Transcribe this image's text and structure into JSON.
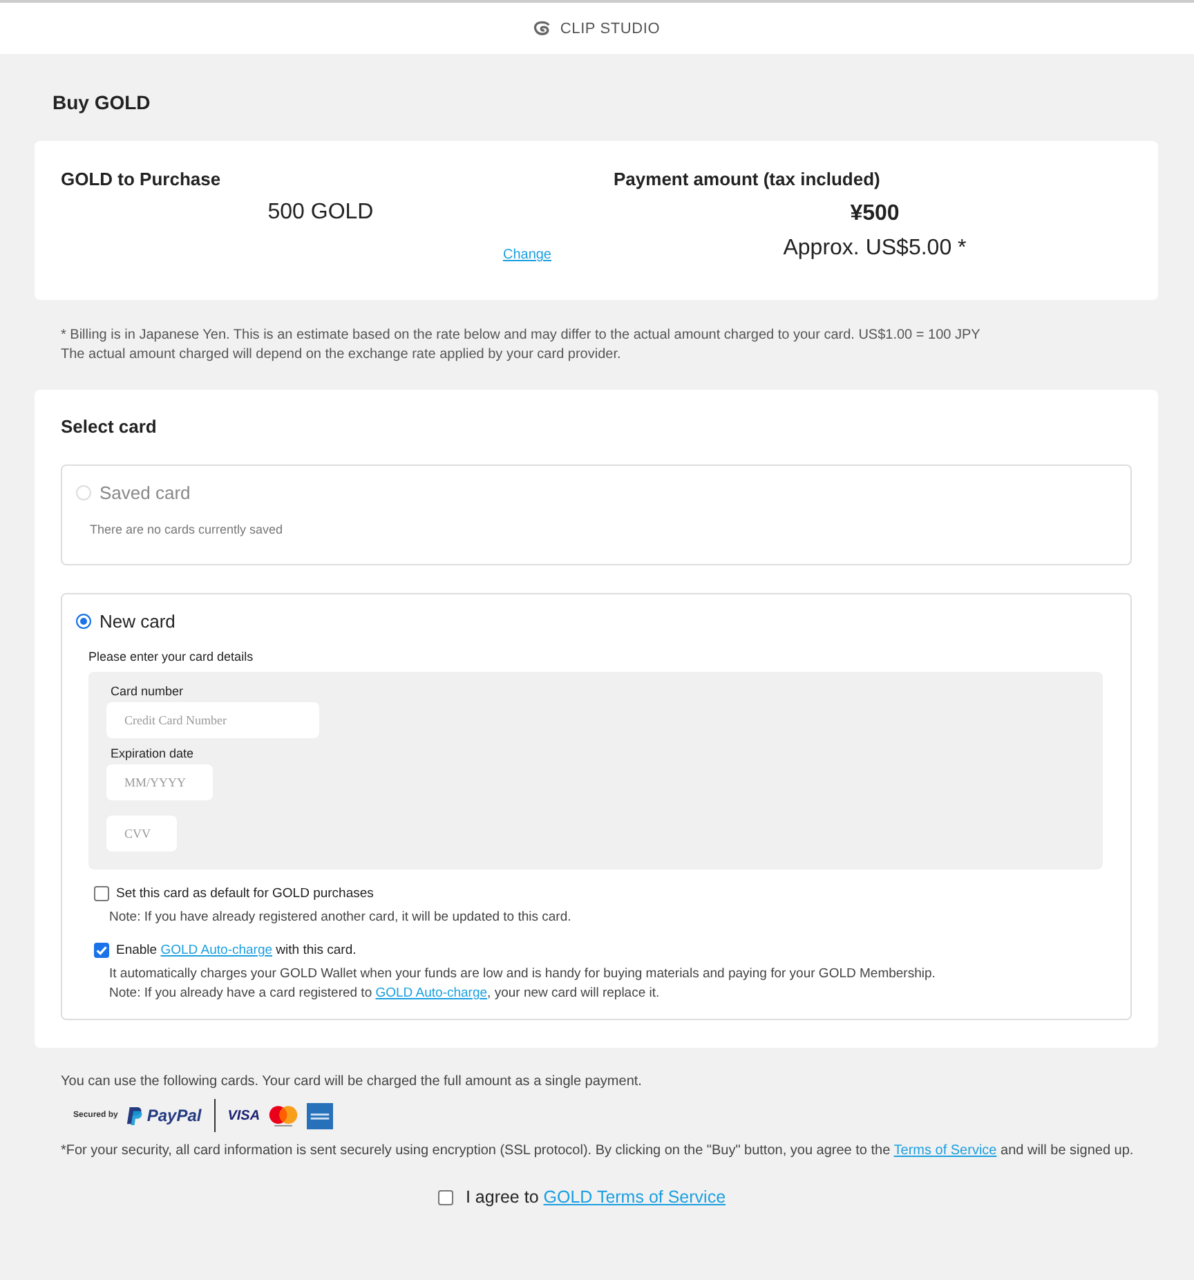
{
  "header": {
    "brand": "CLIP STUDIO"
  },
  "page_title": "Buy GOLD",
  "summary": {
    "purchase_label": "GOLD to Purchase",
    "purchase_value": "500 GOLD",
    "change_link": "Change",
    "payment_label": "Payment amount (tax included)",
    "payment_yen": "¥500",
    "payment_usd": "Approx. US$5.00 *"
  },
  "notes": [
    "* Billing is in Japanese Yen. This is an estimate based on the rate below and may differ to the actual amount charged to your card. US$1.00 = 100 JPY",
    "The actual amount charged will depend on the exchange rate applied by your card provider."
  ],
  "select_card": {
    "title": "Select card",
    "options": [
      {
        "kind": "saved",
        "label": "Saved card",
        "selected": false,
        "disabled": true,
        "message": "There are no cards currently saved"
      },
      {
        "kind": "new",
        "label": "New card",
        "selected": true,
        "disabled": false,
        "instruction": "Please enter your card details",
        "fields": [
          {
            "label": "Card number",
            "placeholder": "Credit Card Number",
            "kind": "number"
          },
          {
            "label": "Expiration date",
            "placeholder": "MM/YYYY",
            "kind": "expiry"
          },
          {
            "placeholder": "CVV",
            "kind": "cvv"
          }
        ],
        "checkboxes": [
          {
            "checked": false,
            "label": {
              "before": "Set this card as default for GOLD purchases"
            },
            "notes": [
              {
                "before": "Note: If you have already registered another card, it will be updated to this card."
              }
            ]
          },
          {
            "checked": true,
            "label": {
              "before": "Enable ",
              "link": "GOLD Auto-charge",
              "after": " with this card."
            },
            "notes": [
              {
                "before": "It automatically charges your GOLD Wallet when your funds are low and is handy for buying materials and paying for your GOLD Membership."
              },
              {
                "before": "Note: If you already have a card registered to ",
                "link": "GOLD Auto-charge",
                "after": ", your new card will replace it."
              }
            ]
          }
        ]
      }
    ]
  },
  "cards_info": "You can use the following cards. Your card will be charged the full amount as a single payment.",
  "logos": {
    "secured_by": "Secured by",
    "paypal": "PayPal",
    "visa": "VISA"
  },
  "security_note": {
    "before": "*For your security, all card information is sent securely using encryption (SSL protocol). By clicking on the \"Buy\" button, you agree to the ",
    "link": "Terms of Service",
    "after": " and will be signed up."
  },
  "agree": {
    "checked": false,
    "label": {
      "before": "I agree to ",
      "link": "GOLD Terms of Service"
    }
  }
}
